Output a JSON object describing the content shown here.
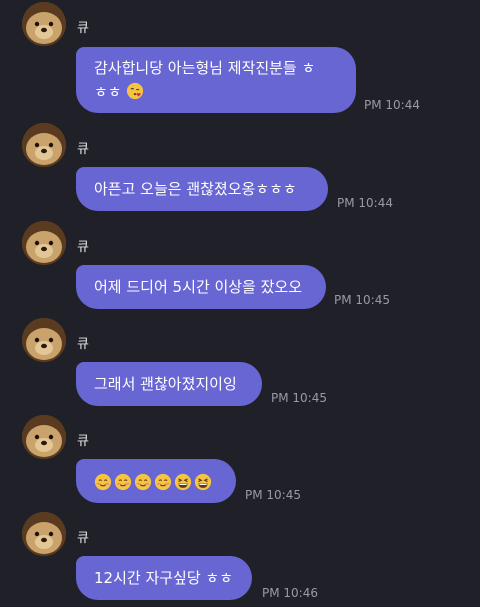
{
  "colors": {
    "background": "#1f2028",
    "bubble": "#6866d3",
    "bubble_text": "#ffffff",
    "timestamp": "#9a9aa3"
  },
  "messages": [
    {
      "sender": "큐",
      "lines": [
        "감사합니당 아는형님 제작진분들 ㅎ",
        "ㅎㅎ"
      ],
      "trailing_emoji": "kissing-face-with-heart-icon",
      "time": "PM 10:44"
    },
    {
      "sender": "큐",
      "lines": [
        "아픈고 오늘은 괜찮졌오옹ㅎㅎㅎ"
      ],
      "time": "PM 10:44"
    },
    {
      "sender": "큐",
      "lines": [
        "어제 드디어 5시간 이상을 잤오오"
      ],
      "time": "PM 10:45"
    },
    {
      "sender": "큐",
      "lines": [
        "그래서 괜찮아졌지이잉"
      ],
      "time": "PM 10:45"
    },
    {
      "sender": "큐",
      "emojis": [
        "smiling-face-icon",
        "smiling-face-icon",
        "smiling-face-icon",
        "smiling-face-icon",
        "grinning-squinting-face-icon",
        "grinning-squinting-face-icon"
      ],
      "time": "PM 10:45"
    },
    {
      "sender": "큐",
      "lines": [
        "12시간 자구싶당 ㅎㅎ"
      ],
      "time": "PM 10:46"
    }
  ]
}
